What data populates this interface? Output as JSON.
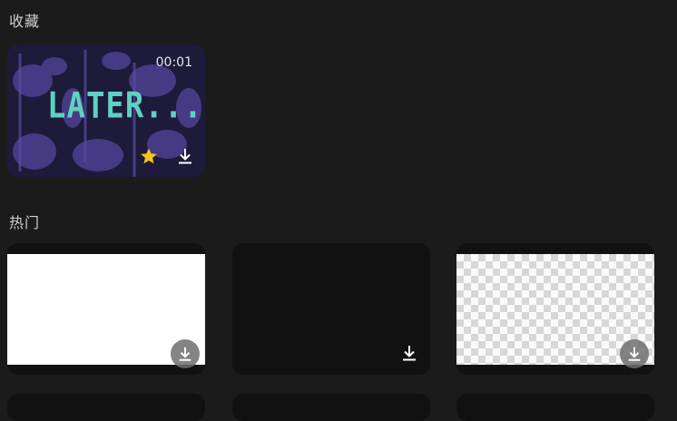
{
  "favorites": {
    "title": "收藏",
    "items": [
      {
        "duration": "00:01",
        "thumbnail_text": "LATER...",
        "favorited": true,
        "star_color": "#f5c518",
        "icon_download": "download-icon",
        "icon_star": "star-icon"
      }
    ]
  },
  "hot": {
    "title": "热门",
    "items": [
      {
        "style": "white",
        "icon_download": "download-icon"
      },
      {
        "style": "black",
        "icon_download": "download-icon"
      },
      {
        "style": "transparent",
        "icon_download": "download-icon"
      }
    ]
  },
  "colors": {
    "background": "#1b1b1b",
    "card": "#111111",
    "accent_text": "#5fd1c2",
    "thumb_purple": "#1d1a3a"
  }
}
